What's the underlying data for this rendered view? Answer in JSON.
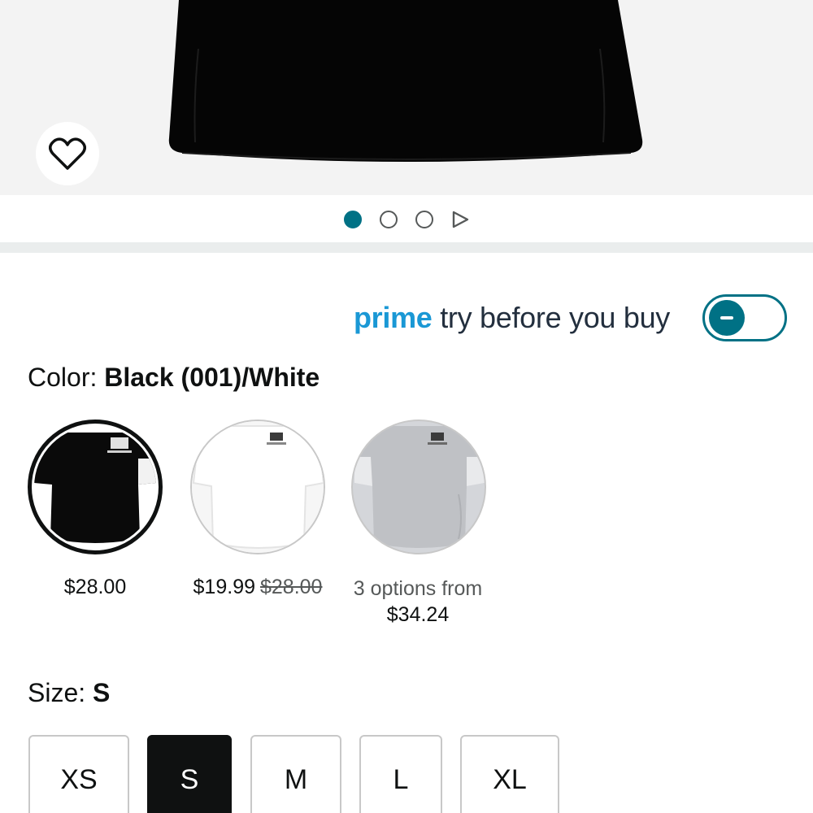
{
  "gallery": {
    "dots": [
      {
        "icon": "dot-filled-icon",
        "active": true
      },
      {
        "icon": "dot-outline-icon",
        "active": false
      },
      {
        "icon": "dot-outline-icon",
        "active": false
      }
    ],
    "video_icon": "play-triangle-icon",
    "wishlist_icon": "heart-outline-icon"
  },
  "prime": {
    "brand": "prime",
    "label": "try before you buy",
    "toggle_on": false,
    "accent": "#007185",
    "brand_color": "#1a98d5"
  },
  "color": {
    "label": "Color:",
    "selected": "Black (001)/White",
    "swatches": [
      {
        "price": "$28.00"
      },
      {
        "price": "$19.99",
        "list_price": "$28.00"
      },
      {
        "options_text": "3 options from",
        "from_price": "$34.24"
      }
    ]
  },
  "size": {
    "label": "Size:",
    "selected": "S",
    "options": [
      "XS",
      "S",
      "M",
      "L",
      "XL"
    ]
  }
}
